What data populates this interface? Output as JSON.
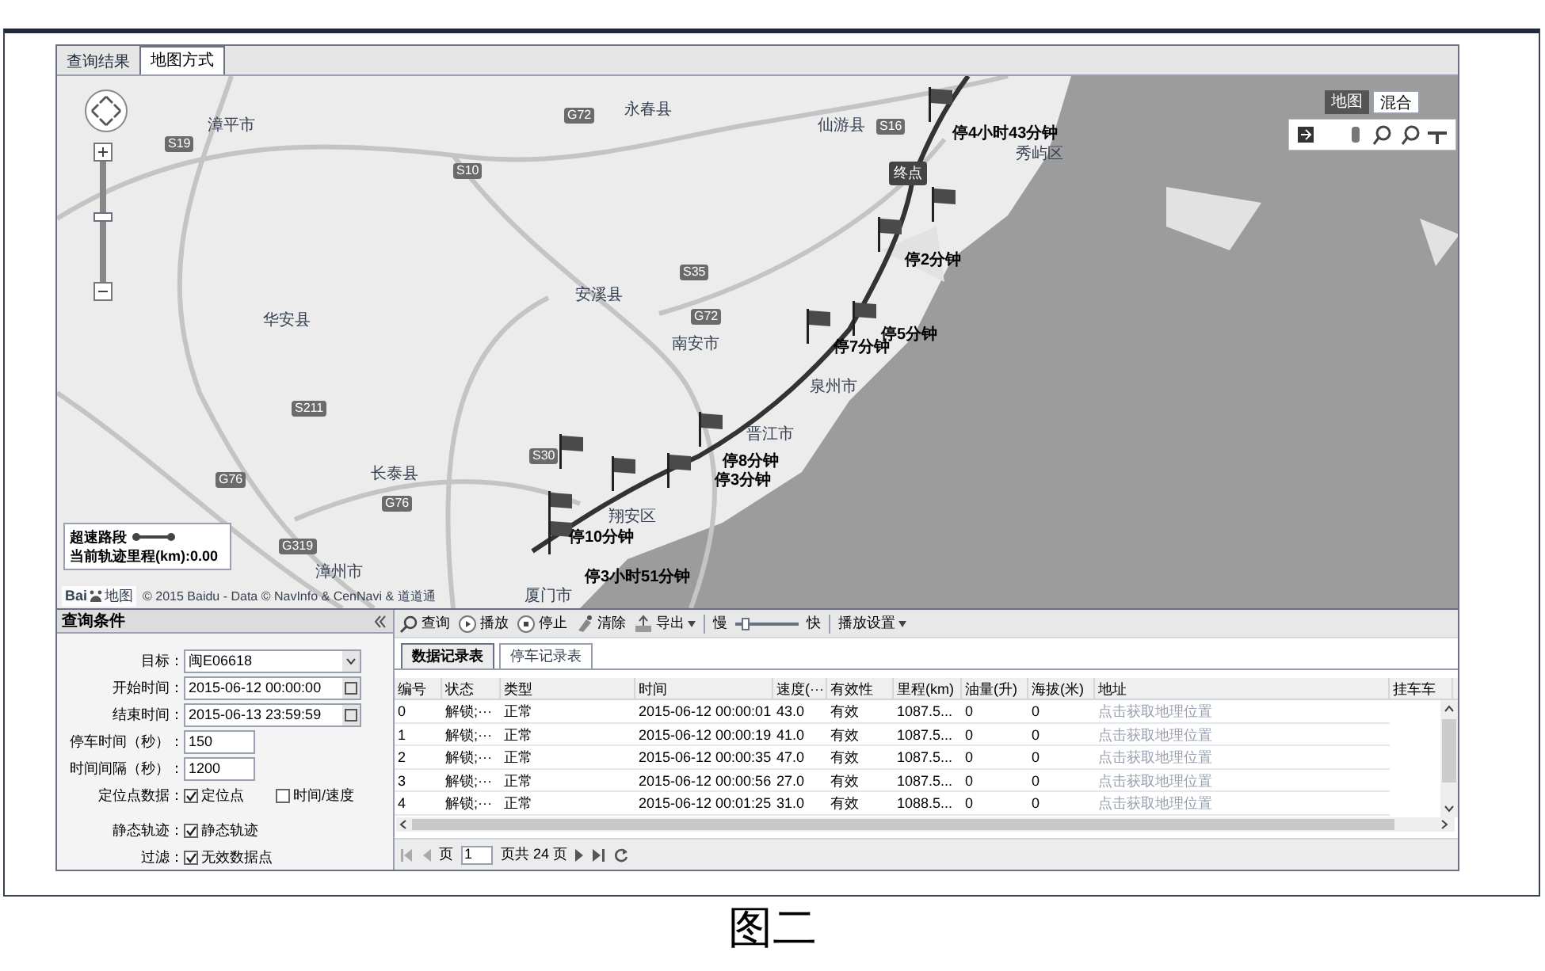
{
  "result_tabs": [
    {
      "label": "查询结果",
      "selected": false
    },
    {
      "label": "地图方式",
      "selected": true
    }
  ],
  "map": {
    "place_labels": [
      "漳平市",
      "永春县",
      "仙游县",
      "秀屿区",
      "安溪县",
      "华安县",
      "南安市",
      "泉州市",
      "晋江市",
      "长泰县",
      "翔安区",
      "漳州市",
      "厦门市"
    ],
    "road_signs": [
      "S19",
      "G72",
      "S10",
      "S35",
      "G72",
      "S211",
      "G76",
      "G76",
      "G319",
      "S30",
      "S16"
    ],
    "stops": [
      "停4小时43分钟",
      "停2分钟",
      "停7分钟",
      "停5分钟",
      "停8分钟",
      "停3分钟",
      "停10分钟",
      "停3小时51分钟"
    ],
    "end_marker": "终点",
    "zoom": {
      "level": 0.55
    },
    "map_types": [
      {
        "label": "地图",
        "selected": true
      },
      {
        "label": "混合",
        "selected": false
      }
    ],
    "legend": {
      "overspeed": "超速路段",
      "mileage": "当前轨迹里程(km):0.00"
    },
    "logo": {
      "text": "Bai",
      "suffix": "地图"
    },
    "copyright": "© 2015 Baidu - Data © NavInfo & CenNavi & 道道通"
  },
  "query_panel": {
    "title": "查询条件",
    "fields": [
      {
        "label": "目标：",
        "value": "闽E06618",
        "kind": "select"
      },
      {
        "label": "开始时间：",
        "value": "2015-06-12 00:00:00",
        "kind": "date"
      },
      {
        "label": "结束时间：",
        "value": "2015-06-13 23:59:59",
        "kind": "date"
      },
      {
        "label": "停车时间（秒）：",
        "value": "150",
        "kind": "text"
      },
      {
        "label": "时间间隔（秒）：",
        "value": "1200",
        "kind": "text"
      }
    ],
    "options": [
      {
        "label": "定位点数据：",
        "checks": [
          {
            "label": "定位点",
            "checked": true
          },
          {
            "label": "时间/速度",
            "checked": false
          }
        ]
      },
      {
        "label": "静态轨迹：",
        "checks": [
          {
            "label": "静态轨迹",
            "checked": true
          }
        ]
      },
      {
        "label": "过滤：",
        "checks": [
          {
            "label": "无效数据点",
            "checked": true
          }
        ]
      }
    ]
  },
  "toolbar": {
    "buttons": [
      {
        "label": "查询",
        "kind": "search"
      },
      {
        "label": "播放",
        "kind": "play"
      },
      {
        "label": "停止",
        "kind": "stop"
      },
      {
        "label": "清除",
        "kind": "clear"
      },
      {
        "label": "导出",
        "kind": "export"
      }
    ],
    "speed": {
      "slow": "慢",
      "fast": "快",
      "level": 0.1
    },
    "settings": "播放设置"
  },
  "record_tabs": [
    {
      "label": "数据记录表",
      "selected": true
    },
    {
      "label": "停车记录表",
      "selected": false
    }
  ],
  "table": {
    "columns": [
      "编号",
      "状态",
      "类型",
      "时间",
      "速度(···",
      "有效性",
      "里程(km)",
      "油量(升)",
      "海拔(米)",
      "地址",
      "挂车车"
    ],
    "rows": [
      [
        "0",
        "解锁;···",
        "正常",
        "2015-06-12 00:00:01",
        "43.0",
        "有效",
        "1087.5...",
        "0",
        "0",
        "点击获取地理位置"
      ],
      [
        "1",
        "解锁;···",
        "正常",
        "2015-06-12 00:00:19",
        "41.0",
        "有效",
        "1087.5...",
        "0",
        "0",
        "点击获取地理位置"
      ],
      [
        "2",
        "解锁;···",
        "正常",
        "2015-06-12 00:00:35",
        "47.0",
        "有效",
        "1087.5...",
        "0",
        "0",
        "点击获取地理位置"
      ],
      [
        "3",
        "解锁;···",
        "正常",
        "2015-06-12 00:00:56",
        "27.0",
        "有效",
        "1087.5...",
        "0",
        "0",
        "点击获取地理位置"
      ],
      [
        "4",
        "解锁;···",
        "正常",
        "2015-06-12 00:01:25",
        "31.0",
        "有效",
        "1088.5...",
        "0",
        "0",
        "点击获取地理位置"
      ]
    ]
  },
  "pager": {
    "page_label": "页",
    "page": "1",
    "total": "页共 24 页"
  },
  "caption": "图二"
}
